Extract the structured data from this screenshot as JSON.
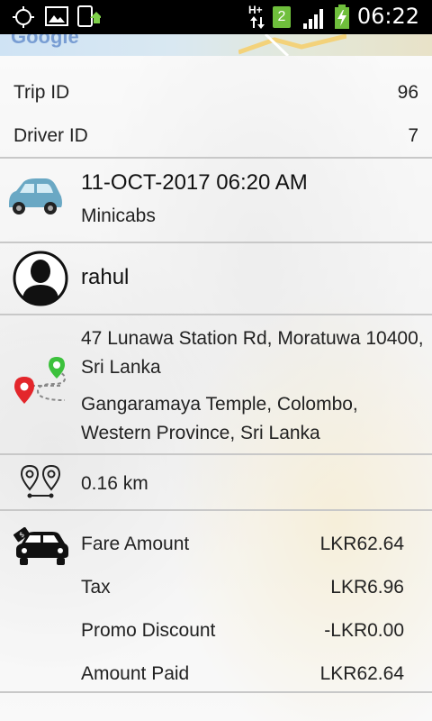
{
  "status_bar": {
    "network": "H+",
    "sim_badge": "2",
    "time": "06:22"
  },
  "map": {
    "attribution": "Google"
  },
  "trip": {
    "trip_id_label": "Trip ID",
    "trip_id": "96",
    "driver_id_label": "Driver ID",
    "driver_id": "7"
  },
  "vehicle": {
    "datetime": "11-OCT-2017 06:20 AM",
    "category": "Minicabs"
  },
  "driver": {
    "name": "rahul"
  },
  "route": {
    "pickup_line1": "47 Lunawa Station Rd, Moratuwa 10400,",
    "pickup_line2": "Sri Lanka",
    "drop_line1": "Gangaramaya Temple, Colombo,",
    "drop_line2": "Western Province, Sri Lanka"
  },
  "distance": {
    "value": "0.16 km"
  },
  "fare": {
    "rows": [
      {
        "label": "Fare Amount",
        "value": "LKR62.64"
      },
      {
        "label": "Tax",
        "value": "LKR6.96"
      },
      {
        "label": "Promo Discount",
        "value": "-LKR0.00"
      },
      {
        "label": "Amount Paid",
        "value": "LKR62.64"
      }
    ]
  },
  "icons": {
    "gps": "gps-icon",
    "image": "image-icon",
    "phone-update": "phone-update-icon",
    "car": "car-icon",
    "avatar": "avatar-icon",
    "route": "route-icon",
    "distance": "distance-pins-icon",
    "fare": "fare-car-icon"
  }
}
